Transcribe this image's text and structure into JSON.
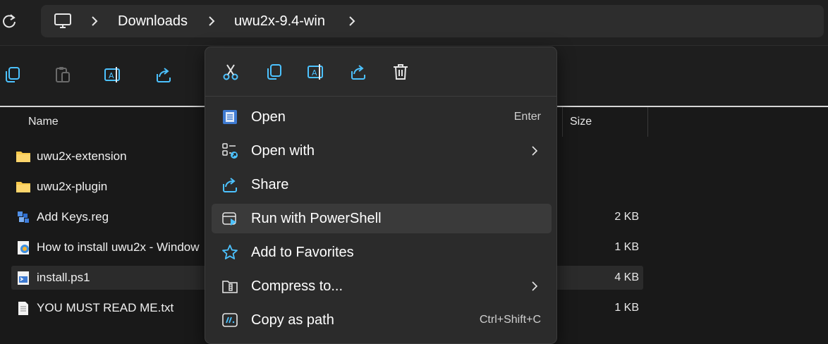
{
  "breadcrumb": {
    "items": [
      "Downloads",
      "uwu2x-9.4-win"
    ]
  },
  "columns": {
    "name": "Name",
    "size": "Size"
  },
  "files": [
    {
      "name": "uwu2x-extension",
      "size": "",
      "icon": "folder-icon"
    },
    {
      "name": "uwu2x-plugin",
      "size": "",
      "icon": "folder-icon"
    },
    {
      "name": "Add Keys.reg",
      "size": "2 KB",
      "icon": "registry-file-icon"
    },
    {
      "name": "How to install uwu2x - Window",
      "size": "1 KB",
      "icon": "web-shortcut-icon"
    },
    {
      "name": "install.ps1",
      "size": "4 KB",
      "icon": "powershell-script-icon",
      "selected": true
    },
    {
      "name": "YOU MUST READ ME.txt",
      "size": "1 KB",
      "icon": "text-file-icon"
    }
  ],
  "context_menu": {
    "quick_actions": [
      "cut-icon",
      "copy-icon",
      "rename-icon",
      "share-icon",
      "delete-icon"
    ],
    "items": [
      {
        "label": "Open",
        "shortcut": "Enter"
      },
      {
        "label": "Open with",
        "shortcut": ""
      },
      {
        "label": "Share",
        "shortcut": ""
      },
      {
        "label": "Run with PowerShell",
        "shortcut": ""
      },
      {
        "label": "Add to Favorites",
        "shortcut": ""
      },
      {
        "label": "Compress to...",
        "shortcut": ""
      },
      {
        "label": "Copy as path",
        "shortcut": "Ctrl+Shift+C"
      }
    ]
  },
  "colors": {
    "accent": "#4cc2ff",
    "folder": "#f8c94a",
    "background": "#191919",
    "menu": "#2b2b2b"
  }
}
